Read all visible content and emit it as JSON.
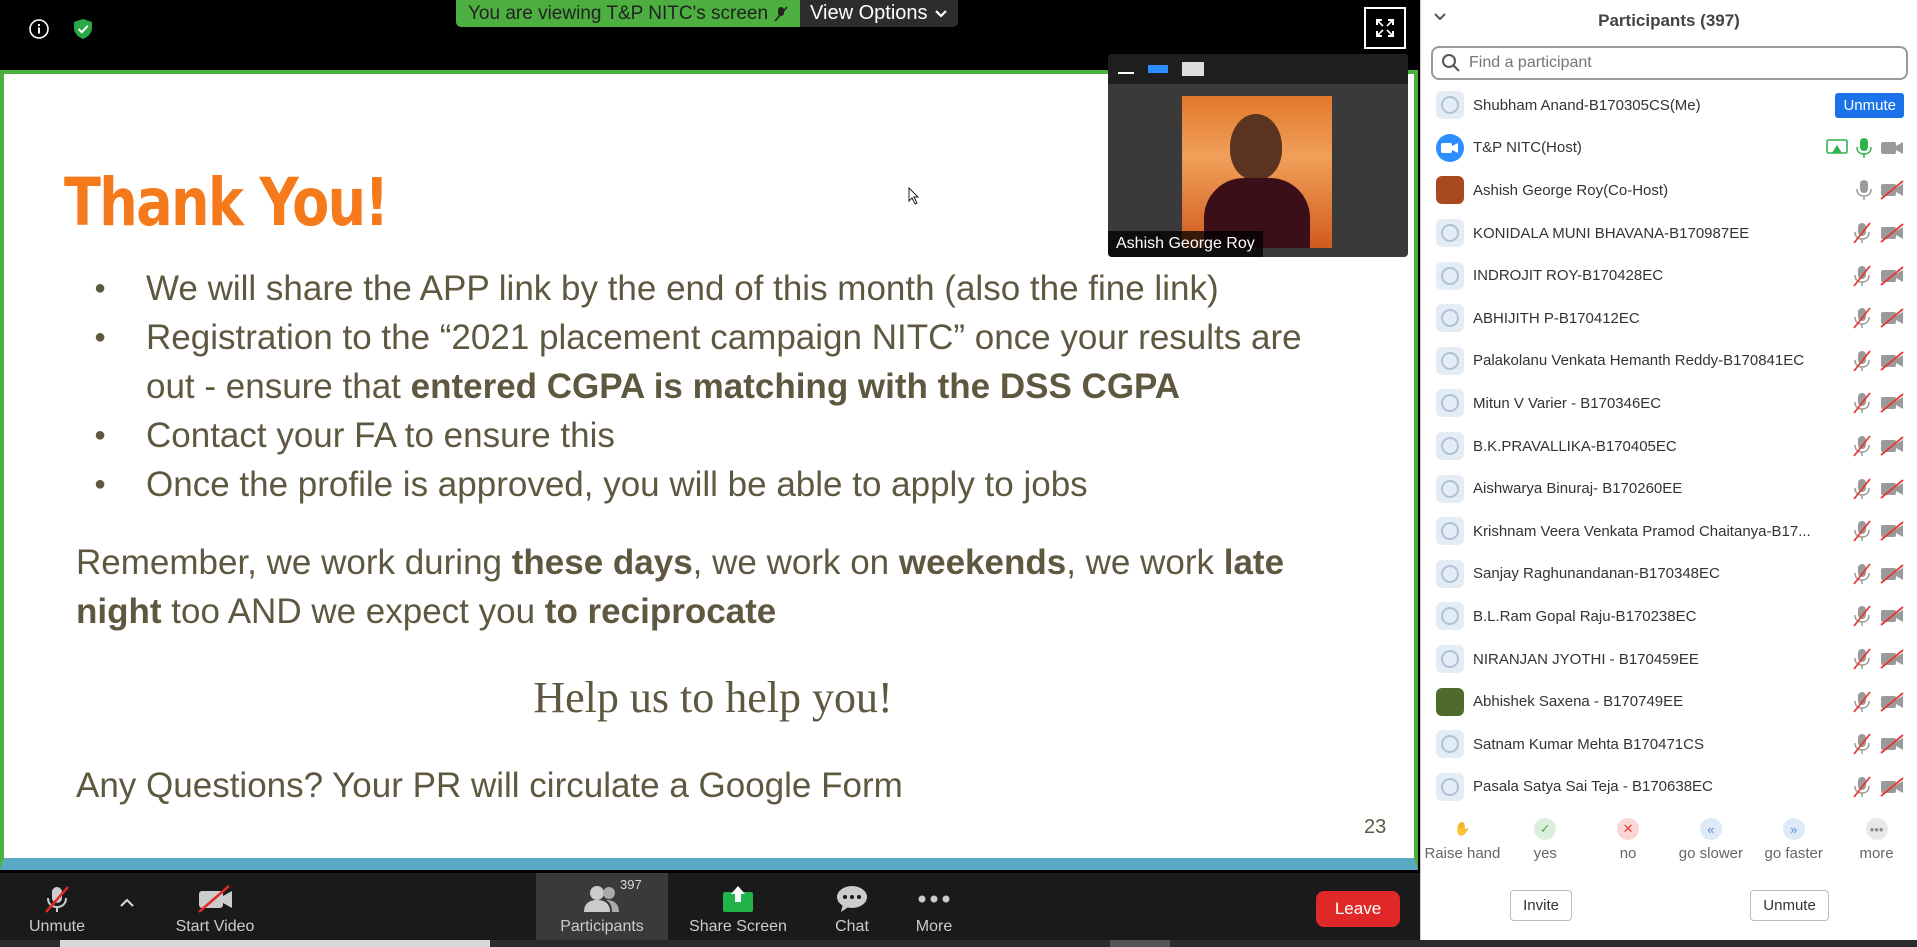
{
  "banner": {
    "viewing_text": "You are viewing T&P NITC's screen",
    "view_options": "View Options"
  },
  "slide": {
    "title": "Thank You!",
    "bullets": [
      {
        "parts": [
          {
            "t": "We will share the APP link by the end of this month (also the fine link)",
            "b": false
          }
        ]
      },
      {
        "parts": [
          {
            "t": "Registration to the “2021 placement campaign NITC” once your results are out - ensure that ",
            "b": false
          },
          {
            "t": "entered CGPA is matching with the DSS CGPA",
            "b": true
          }
        ]
      },
      {
        "parts": [
          {
            "t": "Contact your FA to ensure this",
            "b": false
          }
        ]
      },
      {
        "parts": [
          {
            "t": "Once the profile is approved, you will be able to apply to jobs",
            "b": false
          }
        ]
      }
    ],
    "remember": [
      {
        "t": "Remember, we work during ",
        "b": false
      },
      {
        "t": "these days",
        "b": true
      },
      {
        "t": ", we work on ",
        "b": false
      },
      {
        "t": "weekends",
        "b": true
      },
      {
        "t": ", we work ",
        "b": false
      },
      {
        "t": "late night",
        "b": true
      },
      {
        "t": " too AND we expect you ",
        "b": false
      },
      {
        "t": "to reciprocate",
        "b": true
      }
    ],
    "help": "Help us to help you!",
    "questions": "Any Questions?  Your PR will circulate a Google Form",
    "page_number": "23"
  },
  "video_thumb": {
    "name": "Ashish George Roy"
  },
  "toolbar": {
    "unmute": "Unmute",
    "start_video": "Start Video",
    "participants": "Participants",
    "participants_count": "397",
    "share_screen": "Share Screen",
    "chat": "Chat",
    "more": "More",
    "leave": "Leave"
  },
  "panel": {
    "title": "Participants (397)",
    "search_placeholder": "Find a participant",
    "participants": [
      {
        "name": "Shubham Anand-B170305CS(Me)",
        "avatar": "default",
        "status": "me",
        "action": "Unmute"
      },
      {
        "name": "T&P NITC(Host)",
        "avatar": "zoom",
        "status": "host"
      },
      {
        "name": "Ashish George Roy(Co-Host)",
        "avatar": "photo-a",
        "status": "cohost"
      },
      {
        "name": "KONIDALA MUNI BHAVANA-B170987EE",
        "avatar": "default",
        "status": "muted"
      },
      {
        "name": "INDROJIT ROY-B170428EC",
        "avatar": "default",
        "status": "muted"
      },
      {
        "name": "ABHIJITH P-B170412EC",
        "avatar": "default",
        "status": "muted"
      },
      {
        "name": "Palakolanu Venkata Hemanth Reddy-B170841EC",
        "avatar": "default",
        "status": "muted"
      },
      {
        "name": "Mitun V Varier - B170346EC",
        "avatar": "default",
        "status": "muted"
      },
      {
        "name": "B.K.PRAVALLIKA-B170405EC",
        "avatar": "default",
        "status": "muted"
      },
      {
        "name": "Aishwarya Binuraj- B170260EE",
        "avatar": "default",
        "status": "muted"
      },
      {
        "name": "Krishnam Veera Venkata Pramod Chaitanya-B17...",
        "avatar": "default",
        "status": "muted"
      },
      {
        "name": "Sanjay Raghunandanan-B170348EC",
        "avatar": "default",
        "status": "muted"
      },
      {
        "name": "B.L.Ram Gopal Raju-B170238EC",
        "avatar": "default",
        "status": "muted"
      },
      {
        "name": "NIRANJAN JYOTHI - B170459EE",
        "avatar": "default",
        "status": "muted"
      },
      {
        "name": "Abhishek Saxena - B170749EE",
        "avatar": "photo-b",
        "status": "muted"
      },
      {
        "name": "Satnam Kumar Mehta B170471CS",
        "avatar": "default",
        "status": "muted"
      },
      {
        "name": "Pasala Satya Sai Teja - B170638EC",
        "avatar": "default",
        "status": "muted"
      }
    ],
    "reactions": [
      {
        "label": "Raise hand",
        "icon": "hand-icon",
        "color": "#f3a35a"
      },
      {
        "label": "yes",
        "icon": "check-icon",
        "color": "#4caf50"
      },
      {
        "label": "no",
        "icon": "x-icon",
        "color": "#e53935"
      },
      {
        "label": "go slower",
        "icon": "slower-icon",
        "color": "#5c8fd6"
      },
      {
        "label": "go faster",
        "icon": "faster-icon",
        "color": "#5c8fd6"
      },
      {
        "label": "more",
        "icon": "more-icon",
        "color": "#8a8a8a"
      }
    ],
    "invite": "Invite",
    "unmute": "Unmute"
  },
  "colors": {
    "accent_green": "#4caf3f",
    "slide_title": "#f47a1c",
    "leave_red": "#e02828",
    "unmute_blue": "#1a73e8"
  }
}
